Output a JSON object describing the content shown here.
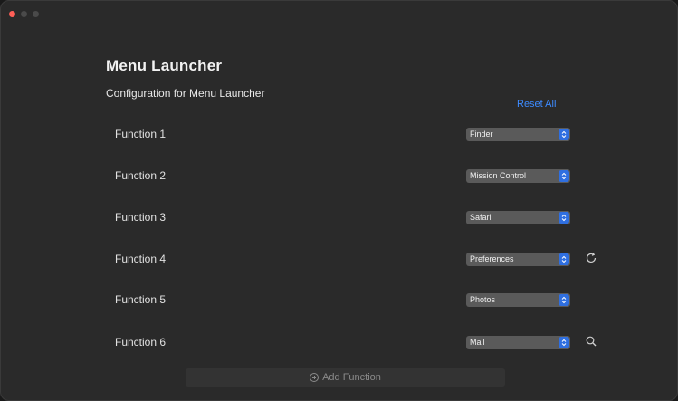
{
  "window": {
    "title": "Menu Launcher"
  },
  "header": {
    "title": "Menu Launcher",
    "subtitle": "Configuration for Menu Launcher",
    "reset_label": "Reset All"
  },
  "functions": [
    {
      "label": "Function 1",
      "value": "Finder"
    },
    {
      "label": "Function 2",
      "value": "Mission Control"
    },
    {
      "label": "Function 3",
      "value": "Safari"
    },
    {
      "label": "Function 4",
      "value": "Preferences",
      "icon": "refresh-icon"
    },
    {
      "label": "Function 5",
      "value": "Photos"
    },
    {
      "label": "Function 6",
      "value": "Mail",
      "icon": "search-icon"
    }
  ],
  "footer": {
    "add_label": "Add Function"
  },
  "colors": {
    "background": "#2a2a2a",
    "accent": "#2f6fe0",
    "link": "#3d8bff",
    "close_button": "#ff5f57"
  }
}
